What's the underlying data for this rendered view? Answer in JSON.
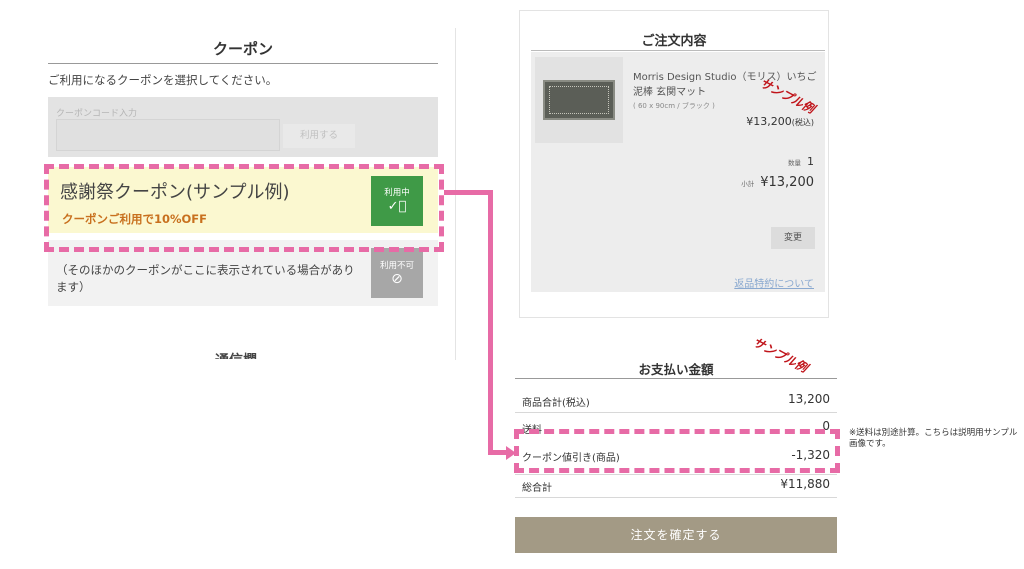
{
  "coupon": {
    "title": "クーポン",
    "instruction": "ご利用になるクーポンを選択してください。",
    "code_label": "クーポンコード入力",
    "code_value": "",
    "apply_button": "利用する",
    "active": {
      "name": "感謝祭クーポン(サンプル例)",
      "description": "クーポンご利用で10%OFF",
      "badge_label": "利用中",
      "badge_icon": "check-circle-icon"
    },
    "other": {
      "text": "（そのほかのクーポンがここに表示されている場合があります）",
      "badge_label": "利用不可",
      "badge_icon": "no-entry-icon"
    },
    "next_section_title": "通信欄"
  },
  "order": {
    "title": "ご注文内容",
    "product": {
      "name": "Morris Design Studio（モリス）いちご泥棒 玄関マット",
      "variant": "( 60 x 90cm / ブラック )",
      "price": "¥13,200",
      "price_tax_note": "(税込)",
      "quantity_label": "数量",
      "quantity": "1",
      "subtotal_label": "小計",
      "subtotal": "¥13,200"
    },
    "change_button": "変更",
    "return_policy_link": "返品特約について"
  },
  "annotations": {
    "sample_label_1": "サンプル例",
    "sample_label_2": "サンプル例",
    "shipping_note": "※送料は別途計算。こちらは説明用サンプル画像です。"
  },
  "payment": {
    "title": "お支払い金額",
    "rows": [
      {
        "label": "商品合計(税込)",
        "value": "13,200"
      },
      {
        "label": "送料",
        "value": "0"
      },
      {
        "label": "クーポン値引き(商品)",
        "value": "-1,320"
      },
      {
        "label": "総合計",
        "value": "¥11,880"
      }
    ],
    "confirm_button": "注文を確定する"
  },
  "colors": {
    "highlight": "#e76ba6",
    "active_badge": "#3f9a47",
    "disabled_badge": "#a7a7a7",
    "active_coupon_bg": "#fbf8d0",
    "discount_text": "#c8701e",
    "confirm_button": "#a39a85",
    "sample_stamp": "#c0141a"
  }
}
